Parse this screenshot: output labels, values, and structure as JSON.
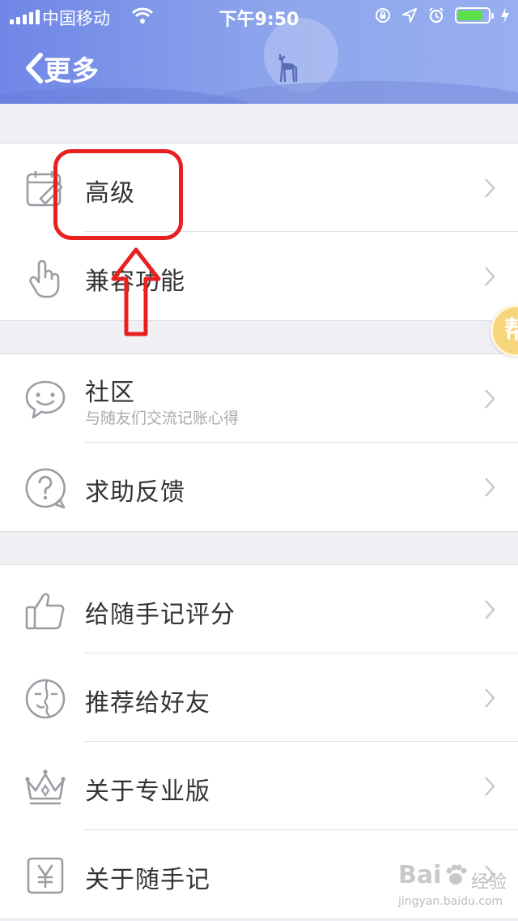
{
  "status_bar": {
    "carrier": "中国移动",
    "time": "下午9:50"
  },
  "header": {
    "back_title": "更多"
  },
  "sections": [
    {
      "rows": [
        {
          "title": "高级",
          "icon": "calendar-edit-icon"
        },
        {
          "title": "兼容功能",
          "icon": "tap-finger-icon"
        }
      ]
    },
    {
      "rows": [
        {
          "title": "社区",
          "subtitle": "与随友们交流记账心得",
          "icon": "chat-smile-icon"
        },
        {
          "title": "求助反馈",
          "icon": "help-question-icon"
        }
      ]
    },
    {
      "rows": [
        {
          "title": "给随手记评分",
          "icon": "thumbs-up-icon"
        },
        {
          "title": "推荐给好友",
          "icon": "face-share-icon"
        },
        {
          "title": "关于专业版",
          "icon": "crown-icon"
        },
        {
          "title": "关于随手记",
          "icon": "yen-doc-icon"
        }
      ]
    }
  ],
  "float_badge": {
    "label": "帮"
  },
  "watermark": {
    "brand": "Bai",
    "jy": "经验",
    "url": "jingyan.baidu.com"
  },
  "colors": {
    "header_start": "#6f86e6",
    "header_end": "#97aef0",
    "annotation": "#e82020",
    "icon_gray": "#9c9ca4"
  }
}
